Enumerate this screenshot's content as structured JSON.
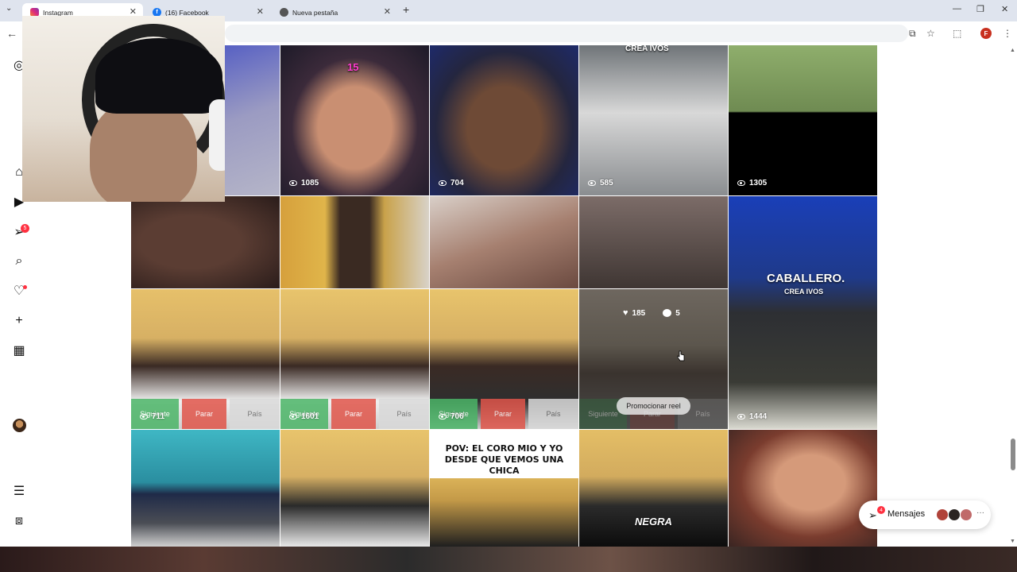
{
  "browser": {
    "tabs": [
      {
        "title": "Instagram",
        "active": true,
        "icon": "instagram-icon"
      },
      {
        "title": "(16) Facebook",
        "active": false,
        "icon": "facebook-icon"
      },
      {
        "title": "Nueva pestaña",
        "active": false,
        "icon": "chrome-icon"
      }
    ],
    "profile_initial": "F"
  },
  "sidebar": {
    "notifications_badge": "5"
  },
  "grid": {
    "tiles": [
      {
        "label": "15",
        "views": "1085"
      },
      {
        "views": "704"
      },
      {
        "label": "CREA IVOS",
        "views": "585"
      },
      {
        "views": "1305"
      },
      {
        "label": "CABALLERO.",
        "sublabel": "CREA IVOS",
        "views": "1444"
      },
      {
        "views": "711",
        "btns": [
          "Siguiente",
          "Parar",
          "País"
        ]
      },
      {
        "views": "1601",
        "btns": [
          "Siguiente",
          "Parar",
          "País"
        ]
      },
      {
        "views": "706",
        "btns": [
          "Siguiente",
          "Parar",
          "País"
        ]
      },
      {
        "likes": "185",
        "comments": "5",
        "promote": "Promocionar reel",
        "btns": [
          "Siguiente",
          "Parar",
          "País"
        ]
      },
      {
        "caption": "POV: EL CORO MIO Y YO DESDE QUE VEMOS UNA CHICA"
      },
      {
        "label": "NEGRA"
      }
    ]
  },
  "messages": {
    "label": "Mensajes",
    "badge": "4"
  }
}
